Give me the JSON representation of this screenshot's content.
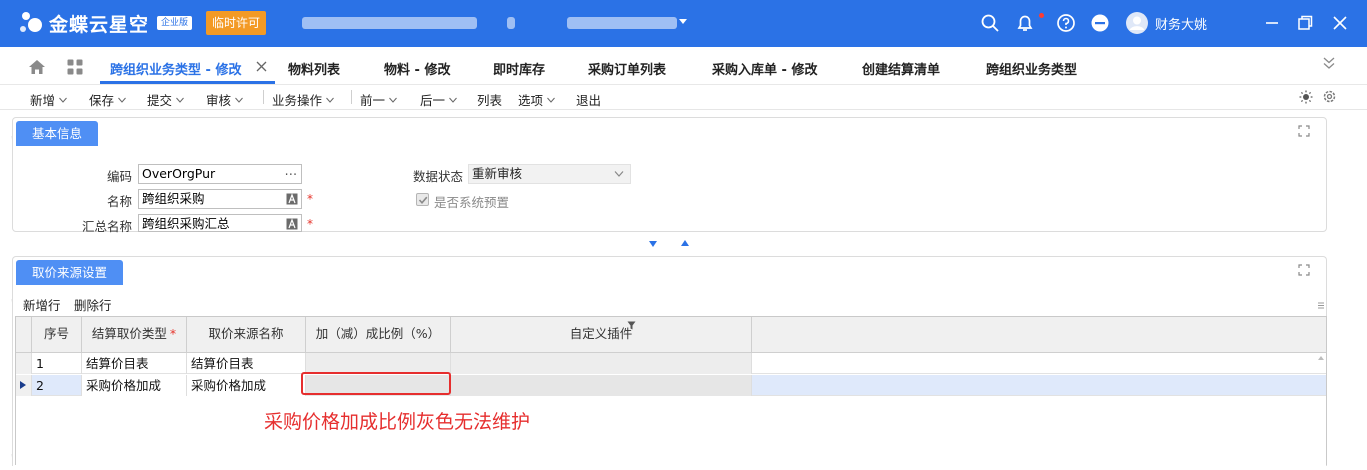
{
  "app": {
    "logo_text": "金蝶云星空",
    "edition": "企业版",
    "license": "临时许可",
    "user_name": "财务大姚"
  },
  "tabs": [
    {
      "label": "跨组织业务类型 - 修改",
      "active": true
    },
    {
      "label": "物料列表"
    },
    {
      "label": "物料 - 修改"
    },
    {
      "label": "即时库存"
    },
    {
      "label": "采购订单列表"
    },
    {
      "label": "采购入库单 - 修改"
    },
    {
      "label": "创建结算清单"
    },
    {
      "label": "跨组织业务类型"
    }
  ],
  "toolbar": [
    {
      "label": "新增",
      "dropdown": true
    },
    {
      "label": "保存",
      "dropdown": true
    },
    {
      "label": "提交",
      "dropdown": true
    },
    {
      "label": "审核",
      "dropdown": true
    },
    {
      "label": "业务操作",
      "dropdown": true
    },
    {
      "label": "前一",
      "dropdown": true
    },
    {
      "label": "后一",
      "dropdown": true
    },
    {
      "label": "列表",
      "dropdown": false
    },
    {
      "label": "选项",
      "dropdown": true
    },
    {
      "label": "退出",
      "dropdown": false
    }
  ],
  "basic_info": {
    "title": "基本信息",
    "code_label": "编码",
    "code_value": "OverOrgPur",
    "name_label": "名称",
    "name_value": "跨组织采购",
    "summary_label": "汇总名称",
    "summary_value": "跨组织采购汇总",
    "status_label": "数据状态",
    "status_value": "重新审核",
    "preset_label": "是否系统预置",
    "preset_checked": true,
    "required_mark": "*"
  },
  "price_source": {
    "title": "取价来源设置",
    "add_row": "新增行",
    "delete_row": "删除行",
    "columns": [
      "序号",
      "结算取价类型",
      "取价来源名称",
      "加（减）成比例（%）",
      "自定义插件"
    ],
    "rows": [
      {
        "seq": "1",
        "type": "结算价目表",
        "source": "结算价目表",
        "ratio": "",
        "plugin": ""
      },
      {
        "seq": "2",
        "type": "采购价格加成",
        "source": "采购价格加成",
        "ratio": "",
        "plugin": ""
      }
    ]
  },
  "annotation": "采购价格加成比例灰色无法维护",
  "watermark": "临时许可",
  "colors": {
    "brand": "#2b72e6",
    "license": "#f39a25",
    "panel_title": "#4f8ff4",
    "annotation": "#e62e2e",
    "selected_row": "#dfe9fb"
  }
}
